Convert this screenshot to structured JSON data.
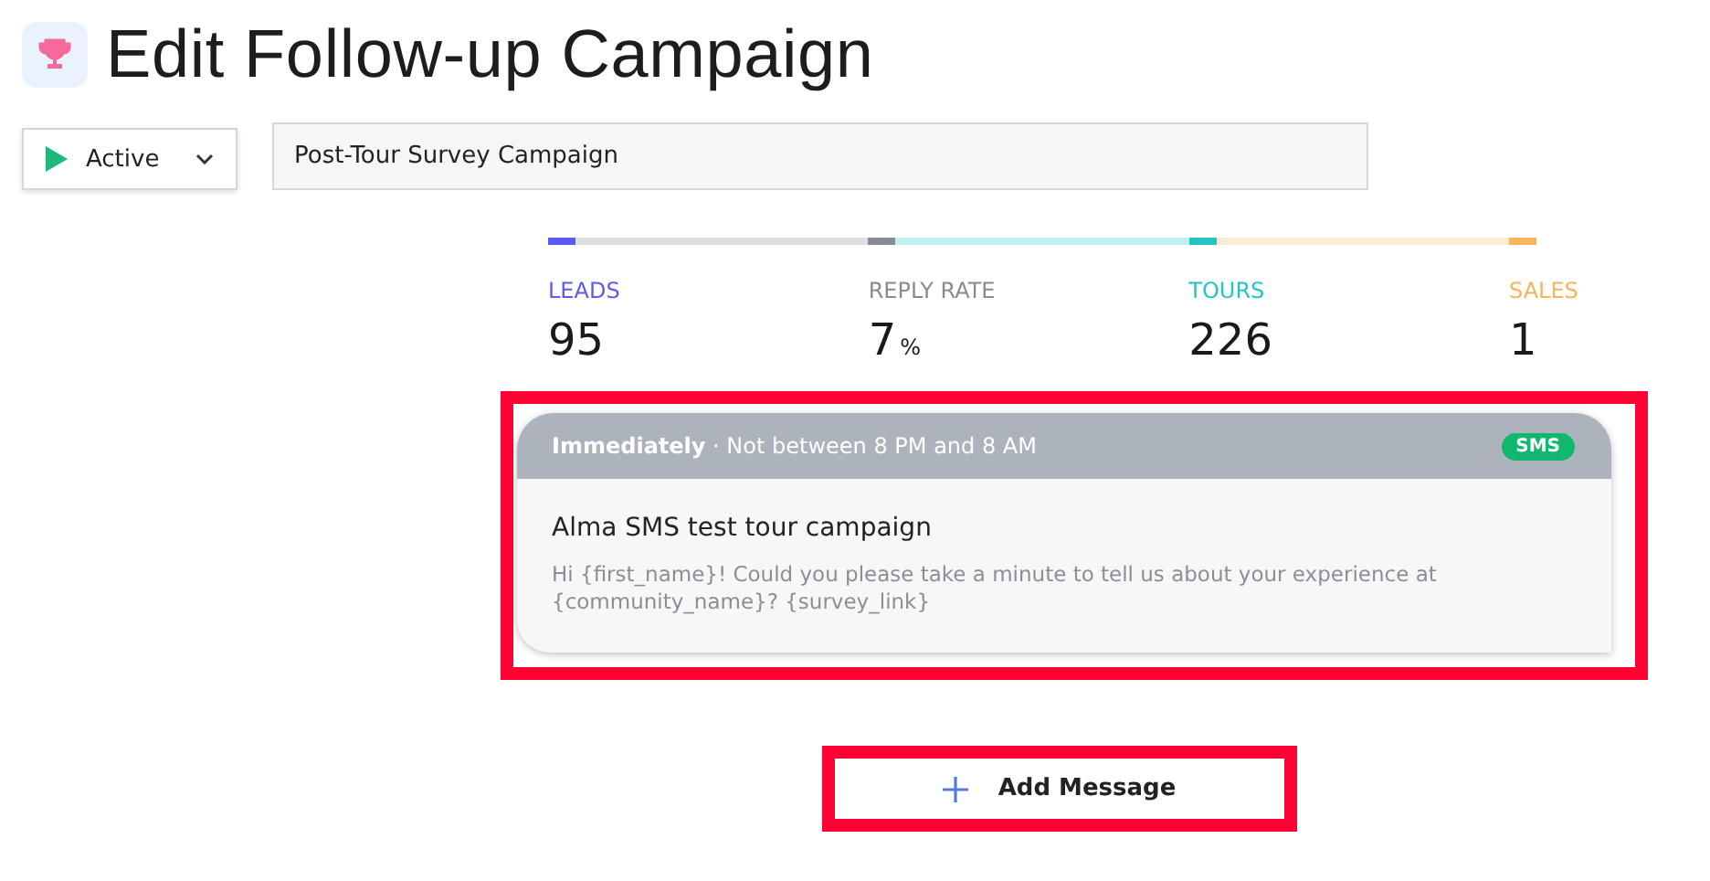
{
  "header": {
    "title": "Edit Follow-up Campaign"
  },
  "status": {
    "label": "Active",
    "running": true
  },
  "name_field": {
    "value": "Post-Tour Survey Campaign"
  },
  "stats": [
    {
      "label": "LEADS",
      "value": "95",
      "color": "#5b5bf0"
    },
    {
      "label": "REPLY RATE",
      "value": "7",
      "unit": "%",
      "color": "#868c96"
    },
    {
      "label": "TOURS",
      "value": "226",
      "color": "#22c4c6"
    },
    {
      "label": "SALES",
      "value": "1",
      "color": "#f5b45e"
    }
  ],
  "messages": [
    {
      "timing": "Immediately",
      "window": " · Not between 8 PM and 8 AM",
      "channel": "SMS",
      "title": "Alma SMS test tour campaign",
      "body": "Hi {first_name}! Could you please take a minute to tell us about your experience at {community_name}? {survey_link}",
      "highlighted": true
    }
  ],
  "add_button": {
    "label": "Add Message",
    "highlighted": true
  }
}
